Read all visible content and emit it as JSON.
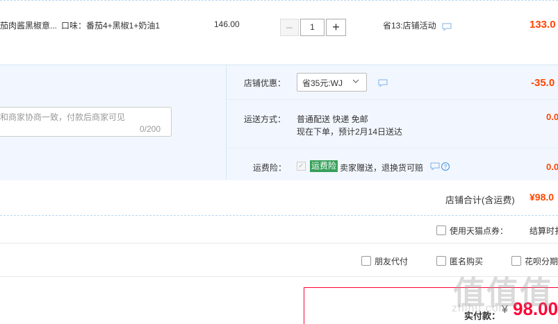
{
  "product": {
    "name": "茄肉酱黑椒意...",
    "spec": "口味：番茄4+黑椒1+奶油1",
    "unit_price": "146.00",
    "quantity": "1",
    "minus": "−",
    "plus": "+",
    "promotion": "省13:店铺活动",
    "subtotal": "133.0"
  },
  "message": {
    "placeholder": "和商家协商一致，付款后商家可见",
    "counter": "0/200"
  },
  "shop": {
    "discount_label": "店铺优惠：",
    "coupon_value": "省35元:WJ",
    "discount_amount": "-35.0",
    "shipping_label": "运送方式：",
    "shipping_line1": "普通配送 快递 免邮",
    "shipping_line2": "现在下单，预计2月14日送达",
    "shipping_amount": "0.0",
    "insurance_label": "运费险：",
    "insurance_badge": "运费险",
    "insurance_desc": "卖家赠送，退换货可赔",
    "insurance_amount": "0.0",
    "total_label": "店铺合计(含运费)",
    "total_value": "¥98.0"
  },
  "options": {
    "points_label": "使用天猫点券：",
    "settle_label": "结算时扌",
    "friend_pay": "朋友代付",
    "anonymous": "匿名购买",
    "huabei": "花呗分期"
  },
  "payment": {
    "label": "实付款：",
    "currency": "¥",
    "value": "98.00"
  },
  "watermark": {
    "main": "值值值",
    "sub": "zhihu.com"
  },
  "colors": {
    "accent": "#ff4400",
    "pay_red": "#ff0036",
    "panel_bg": "#f2f7ff",
    "badge_green": "#38a05a"
  }
}
